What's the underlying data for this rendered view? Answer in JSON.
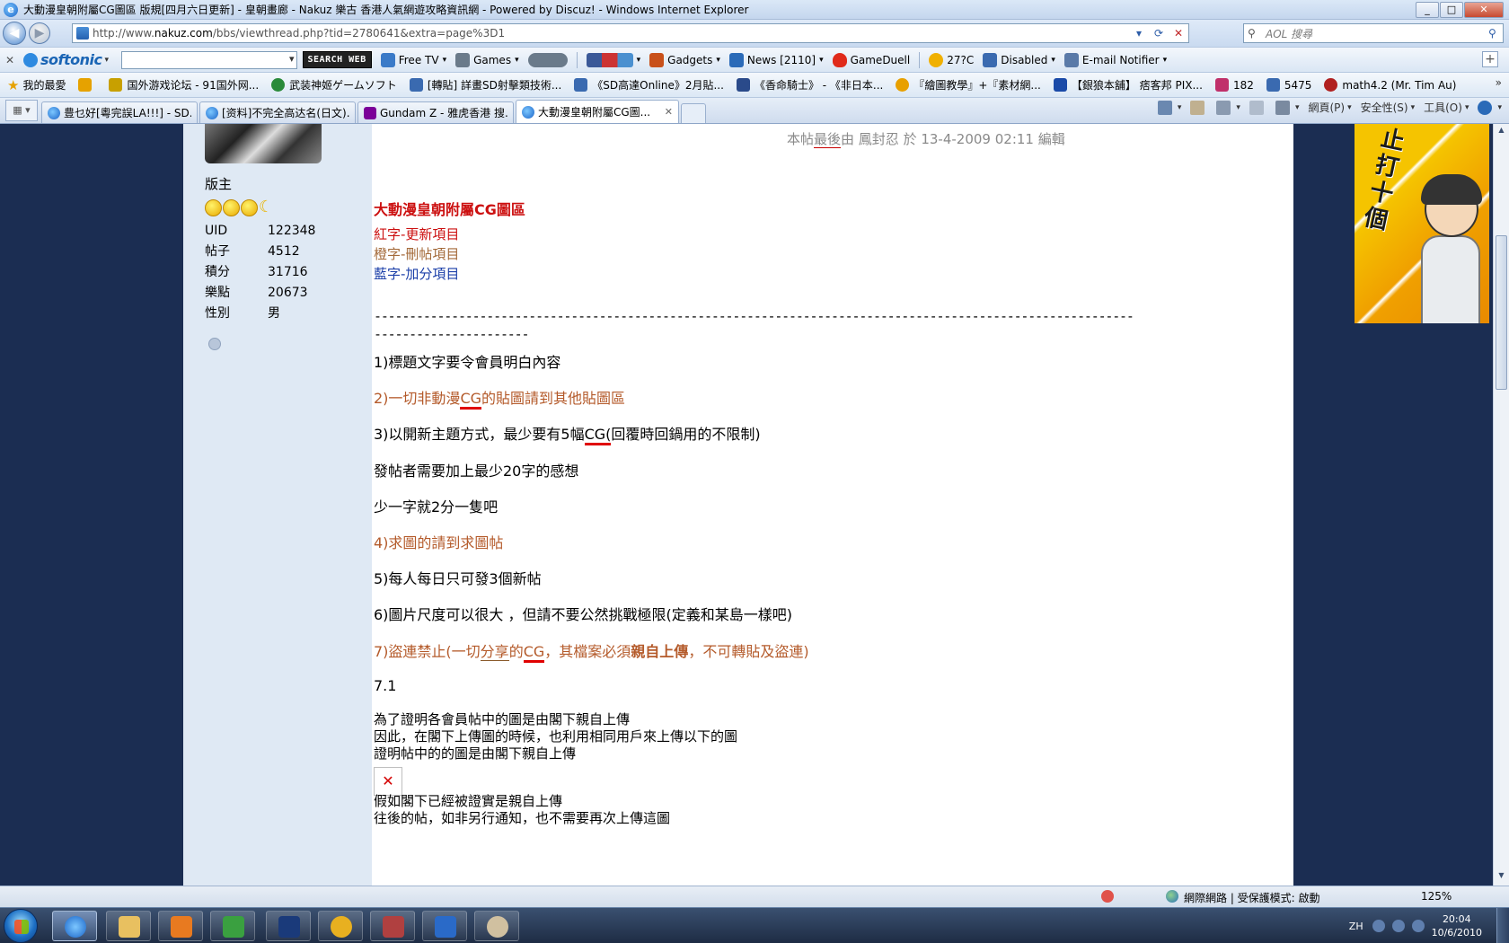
{
  "window": {
    "title": "大動漫皇朝附屬CG圖區 版規[四月六日更新] - 皇朝畫廊 - Nakuz 樂古 香港人氣網遊攻略資訊網 - Powered by Discuz! - Windows Internet Explorer"
  },
  "nav": {
    "url_prefix": "http://www.",
    "url_domain": "nakuz.com",
    "url_path": "/bbs/viewthread.php?tid=2780641&extra=page%3D1",
    "search_placeholder": "AOL 搜尋"
  },
  "toolbar": {
    "brand": "softonic",
    "search_web_label": "SEARCH WEB",
    "items": [
      {
        "label": "Free TV",
        "color": "#3a7ac8"
      },
      {
        "label": "Games",
        "color": "#6a7a8a"
      },
      {
        "label": "Gadgets",
        "color": "#c8501a"
      },
      {
        "label": "News [2110]",
        "color": "#2a6ab8"
      },
      {
        "label": "GameDuell",
        "color": "#e02a1a"
      },
      {
        "label": "27?C",
        "color": "#f0b000"
      },
      {
        "label": "Disabled",
        "color": "#3a6ab0"
      },
      {
        "label": "E-mail Notifier",
        "color": "#5a7aa8"
      }
    ]
  },
  "favorites": {
    "root_label": "我的最愛",
    "items": [
      {
        "label": "国外游戏论坛 - 91国外网...",
        "color": "#c8a000"
      },
      {
        "label": "武装神姬ゲームソフト",
        "color": "#2a8a3a"
      },
      {
        "label": "[轉貼] 詳畫SD射擊類技術...",
        "color": "#3a6ab0"
      },
      {
        "label": "《SD高達Online》2月貼...",
        "color": "#3a6ab0"
      },
      {
        "label": "《香命騎士》 - 《非日本...",
        "color": "#2a4a8a"
      },
      {
        "label": "『繪圖教學』+『素材網...",
        "color": "#e8a000"
      },
      {
        "label": "【銀狼本舖】 痞客邦 PIX...",
        "color": "#1a4aa8"
      },
      {
        "label": "182",
        "color": "#c0306a"
      },
      {
        "label": "5475",
        "color": "#3a6ab0"
      },
      {
        "label": "math4.2 (Mr. Tim Au)",
        "color": "#b02020"
      }
    ]
  },
  "tabs": {
    "items": [
      {
        "label": "豊乜好[粵完誤LA!!!] - SD...",
        "active": false
      },
      {
        "label": "[资料]不完全高达名(日文)...",
        "active": false
      },
      {
        "label": "Gundam Z - 雅虎香港 搜...",
        "active": false
      },
      {
        "label": "大動漫皇朝附屬CG圖...",
        "active": true
      }
    ],
    "commands": [
      {
        "label": "網頁(P)"
      },
      {
        "label": "安全性(S)"
      },
      {
        "label": "工具(O)"
      }
    ]
  },
  "profile": {
    "rank": "版主",
    "stats": [
      {
        "key": "UID",
        "value": "122348"
      },
      {
        "key": "帖子",
        "value": "4512"
      },
      {
        "key": "積分",
        "value": "31716"
      },
      {
        "key": "樂點",
        "value": "20673"
      },
      {
        "key": "性別",
        "value": "男"
      }
    ]
  },
  "post": {
    "edited_prefix": "本帖",
    "edited_mid": "最後",
    "edited_suffix": "由 鳳封忍 於 13-4-2009 02:11 編輯",
    "ad_text": "止打十個",
    "title": "大動漫皇朝附屬CG圖區",
    "legend_red": "紅字-更新項目",
    "legend_orange": "橙字-刪帖項目",
    "legend_blue": "藍字-加分項目",
    "dashes_1": "------------------------------------------------------------------------------------------------------------",
    "dashes_2": "----------------------",
    "rule1": "1)標題文字要令會員明白內容",
    "rule2_a": "2)一切非動漫",
    "rule2_cg": "CG",
    "rule2_b": "的貼圖請到其他貼圖區",
    "rule3_a": "3)以開新主題方式，最少要有5幅",
    "rule3_cg": "CG(",
    "rule3_b": "回覆時回鍋用的不限制)",
    "rule3_note": "發帖者需要加上最少20字的感想",
    "rule3_note2": "少一字就2分一隻吧",
    "rule4": "4)求圖的請到求圖帖",
    "rule5": "5)每人每日只可發3個新帖",
    "rule6": "6)圖片尺度可以很大 ，但請不要公然挑戰極限(定義和某島一樣吧)",
    "rule7_a": "7)盜連禁止(一切",
    "rule7_share": "分享",
    "rule7_b": "的",
    "rule7_cg": "CG",
    "rule7_c": "，其檔案必須",
    "rule7_bold": "親自上傳",
    "rule7_d": "，不可轉貼及盜連)",
    "rule71": "7.1",
    "p1": "為了證明各會員帖中的圖是由閣下親自上傳",
    "p2": "因此，在閣下上傳圖的時候，也利用相同用戶來上傳以下的圖",
    "p3": "證明帖中的的圖是由閣下親自上傳",
    "p4": "假如閣下已經被證實是親自上傳",
    "p5": "往後的帖，如非另行通知，也不需要再次上傳這圖"
  },
  "status": {
    "zone": "網際網路 | 受保護模式: 啟動",
    "zoom": "125%"
  },
  "taskbar": {
    "lang": "ZH",
    "time": "20:04",
    "date": "10/6/2010"
  }
}
